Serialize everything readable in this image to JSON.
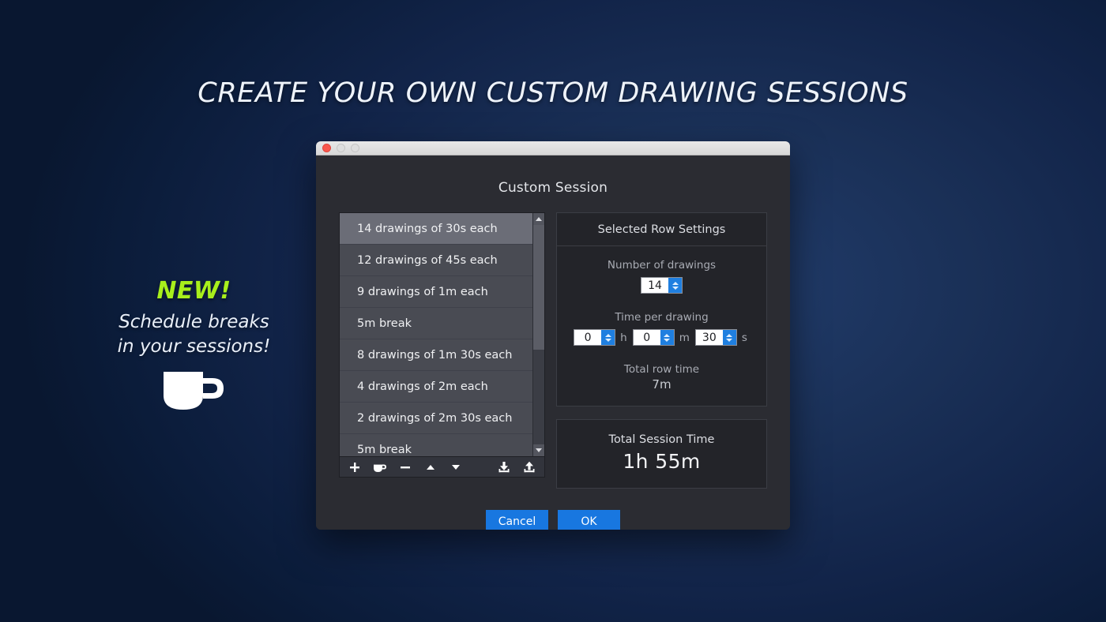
{
  "headline": "CREATE YOUR OWN CUSTOM DRAWING SESSIONS",
  "promo": {
    "badge": "NEW!",
    "subtitle": "Schedule breaks in your sessions!",
    "icon": "coffee-cup-icon"
  },
  "window": {
    "traffic_lights": [
      "close",
      "minimize",
      "zoom"
    ],
    "dialog_title": "Custom Session"
  },
  "session_list": {
    "rows": [
      {
        "label": "14 drawings of 30s each",
        "selected": true
      },
      {
        "label": "12 drawings of 45s each",
        "selected": false
      },
      {
        "label": "9 drawings of 1m each",
        "selected": false
      },
      {
        "label": "5m break",
        "selected": false
      },
      {
        "label": "8 drawings of 1m 30s each",
        "selected": false
      },
      {
        "label": "4 drawings of 2m each",
        "selected": false
      },
      {
        "label": "2 drawings of 2m 30s each",
        "selected": false
      },
      {
        "label": "5m break",
        "selected": false
      }
    ],
    "scrollbar": {
      "thumb_percent": 57
    },
    "toolbar": [
      {
        "name": "add-row-button",
        "icon": "plus-icon"
      },
      {
        "name": "add-break-button",
        "icon": "coffee-cup-icon"
      },
      {
        "name": "remove-row-button",
        "icon": "minus-icon"
      },
      {
        "name": "move-up-button",
        "icon": "triangle-up-icon"
      },
      {
        "name": "move-down-button",
        "icon": "triangle-down-icon"
      },
      {
        "name": "import-button",
        "icon": "download-icon"
      },
      {
        "name": "export-button",
        "icon": "upload-icon"
      }
    ]
  },
  "settings": {
    "panel_title": "Selected Row Settings",
    "number_of_drawings": {
      "label": "Number of drawings",
      "value": "14"
    },
    "time_per_drawing": {
      "label": "Time per drawing",
      "hours": {
        "value": "0",
        "unit": "h"
      },
      "minutes": {
        "value": "0",
        "unit": "m"
      },
      "seconds": {
        "value": "30",
        "unit": "s"
      }
    },
    "total_row_time": {
      "label": "Total row time",
      "value": "7m"
    }
  },
  "session_total": {
    "label": "Total Session Time",
    "value": "1h 55m"
  },
  "footer": {
    "cancel_label": "Cancel",
    "ok_label": "OK"
  },
  "colors": {
    "accent_blue": "#1877e0",
    "new_green": "#a8ef1c",
    "background_navy": "#0a1d3c",
    "selected_row": "#6b6d77"
  }
}
